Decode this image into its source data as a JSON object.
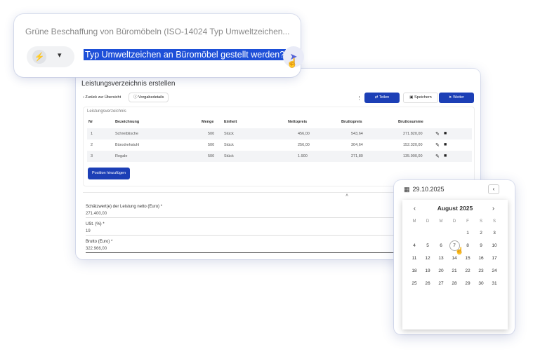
{
  "prompt": {
    "subtitle": "Grüne Beschaffung von Büromöbeln (ISO-14024 Typ Umweltzeichen...",
    "selected_text": "Typ Umweltzeichen an Büromöbel gestellt werden?",
    "mode_icon": "bolt-icon",
    "send_icon": "send-icon"
  },
  "app": {
    "title": "Leistungsverzeichnis erstellen",
    "back_label": "Zurück zur Übersicht",
    "details_label": "Vorgabedetails",
    "actions": {
      "share": "Teilen",
      "save": "Speichern",
      "next": "Weiter"
    },
    "table": {
      "section_label": "Leistungsverzeichnis",
      "headers": [
        "Nr",
        "Bezeichnung",
        "Menge",
        "Einheit",
        "Nettopreis",
        "Bruttopreis",
        "Bruttosumme"
      ],
      "rows": [
        [
          "1",
          "Schreibtische",
          "500",
          "Stück",
          "456,00",
          "543,64",
          "271.820,00"
        ],
        [
          "2",
          "Bürodrehstuhl",
          "500",
          "Stück",
          "256,00",
          "304,64",
          "152.320,00"
        ],
        [
          "3",
          "Regale",
          "500",
          "Stück",
          "1.900",
          "271,80",
          "135.900,00"
        ]
      ],
      "add_label": "Position hinzufügen"
    },
    "fields": [
      {
        "label": "Schätzwert(e) der Leistung netto (Euro) *",
        "value": "271.400,00"
      },
      {
        "label": "USt. (%) *",
        "value": "19"
      },
      {
        "label": "Brutto (Euro) *",
        "value": "322.966,00"
      }
    ]
  },
  "calendar": {
    "input_value": "29.10.2025",
    "month_label": "August 2025",
    "weekdays": [
      "M",
      "D",
      "M",
      "D",
      "F",
      "S",
      "S"
    ],
    "weeks": [
      [
        "",
        "",
        "",
        "",
        "1",
        "2",
        "3"
      ],
      [
        "4",
        "5",
        "6",
        "7",
        "8",
        "9",
        "10"
      ],
      [
        "11",
        "12",
        "13",
        "14",
        "15",
        "16",
        "17"
      ],
      [
        "18",
        "19",
        "20",
        "21",
        "22",
        "23",
        "24"
      ],
      [
        "25",
        "26",
        "27",
        "28",
        "29",
        "30",
        "31"
      ]
    ],
    "hovered_day": "7"
  }
}
